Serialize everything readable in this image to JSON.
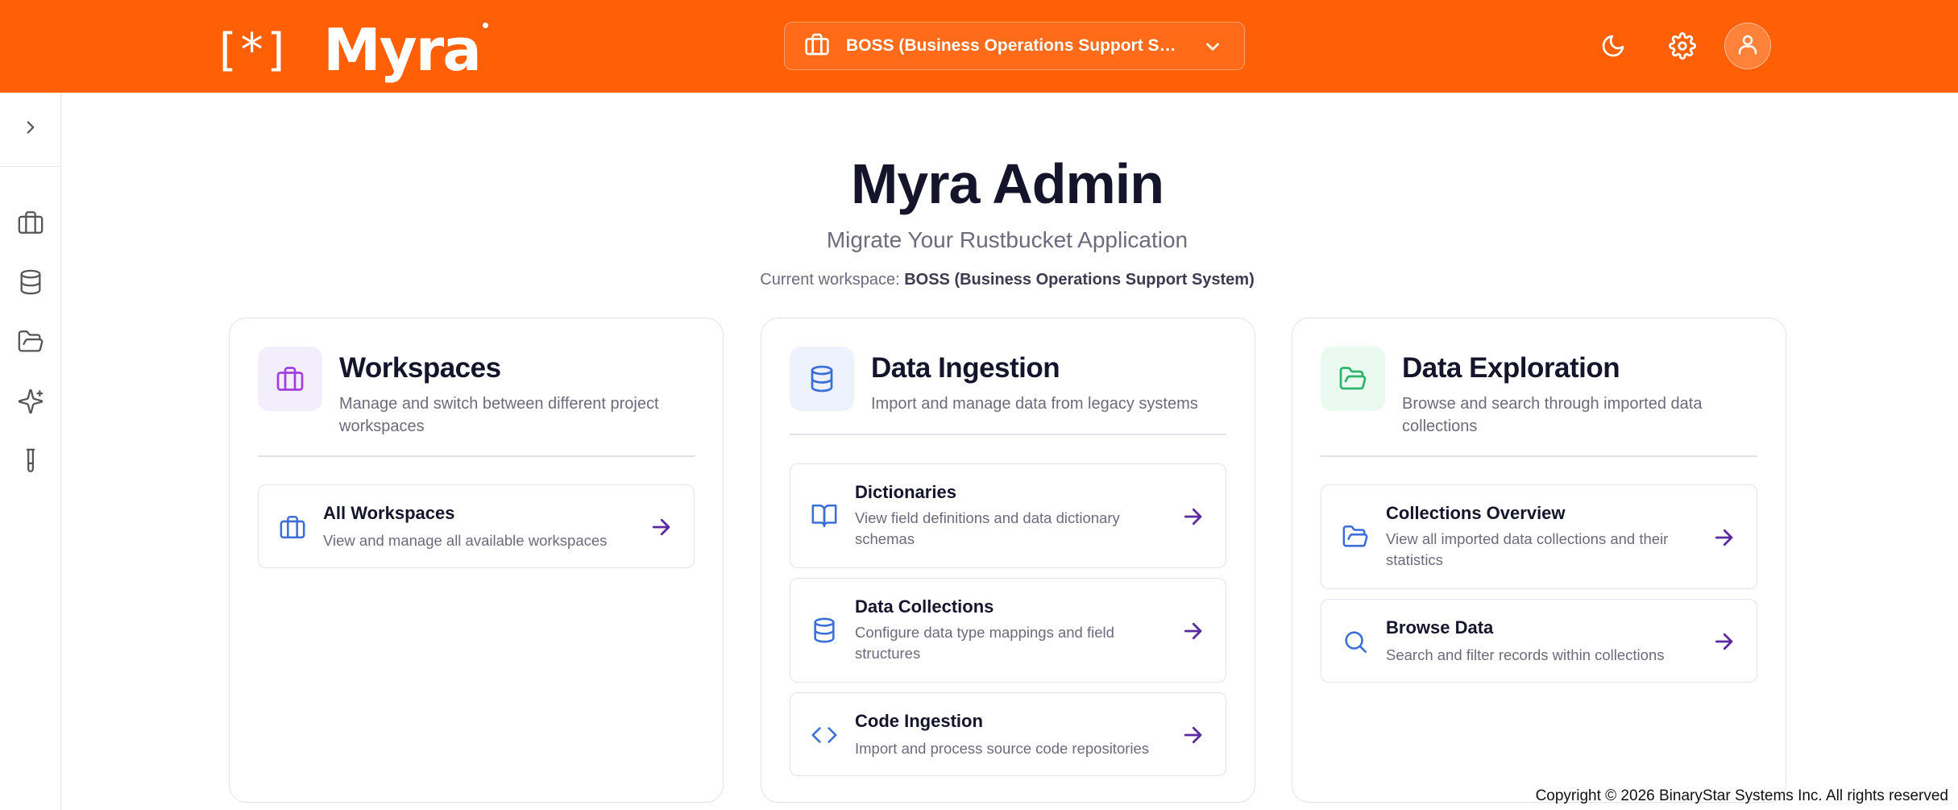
{
  "header": {
    "logo_mark": "[*]",
    "logo_text": "Myra",
    "workspace_selector": "BOSS (Business Operations Support Syst...",
    "brand_color": "#ff5f05"
  },
  "sidebar": {
    "items": [
      {
        "icon": "briefcase-icon"
      },
      {
        "icon": "database-icon"
      },
      {
        "icon": "folder-open-icon"
      },
      {
        "icon": "sparkles-icon"
      },
      {
        "icon": "test-tube-icon"
      }
    ]
  },
  "main": {
    "title": "Myra Admin",
    "subtitle": "Migrate Your Rustbucket Application",
    "current_workspace_label": "Current workspace:",
    "current_workspace_value": "BOSS (Business Operations Support System)"
  },
  "cards": [
    {
      "title": "Workspaces",
      "description": "Manage and switch between different project workspaces",
      "items": [
        {
          "title": "All Workspaces",
          "description": "View and manage all available workspaces"
        }
      ]
    },
    {
      "title": "Data Ingestion",
      "description": "Import and manage data from legacy systems",
      "items": [
        {
          "title": "Dictionaries",
          "description": "View field definitions and data dictionary schemas"
        },
        {
          "title": "Data Collections",
          "description": "Configure data type mappings and field structures"
        },
        {
          "title": "Code Ingestion",
          "description": "Import and process source code repositories"
        }
      ]
    },
    {
      "title": "Data Exploration",
      "description": "Browse and search through imported data collections",
      "items": [
        {
          "title": "Collections Overview",
          "description": "View all imported data collections and their statistics"
        },
        {
          "title": "Browse Data",
          "description": "Search and filter records within collections"
        }
      ]
    }
  ],
  "footer": {
    "copyright": "Copyright © 2026 BinaryStar Systems Inc. All rights reserved"
  }
}
